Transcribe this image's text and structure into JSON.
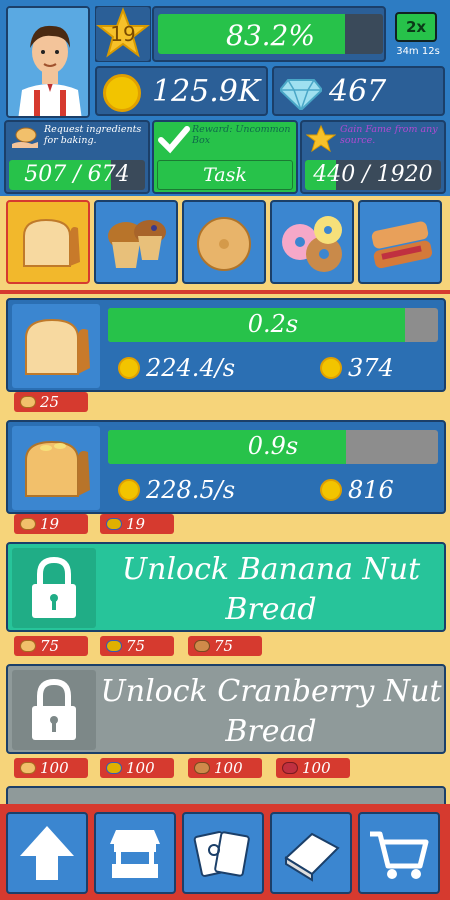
{
  "hud": {
    "level": "19",
    "xp_percent_text": "83.2%",
    "xp_fraction": 0.832,
    "boost": {
      "label": "2x",
      "time": "34m 12s"
    },
    "coins": "125.9K",
    "gems": "467"
  },
  "missions": [
    {
      "text": "Request ingredients for baking.",
      "progress": "507 / 674",
      "fraction": 0.752
    },
    {
      "text": "Reward: Uncommon Box",
      "progress": "Task Complete!",
      "fraction": 1.0
    },
    {
      "text": "Gain Fame from any source.",
      "progress": "440 / 1920",
      "fraction": 0.229
    }
  ],
  "tabs": [
    "bread-loaf",
    "muffins",
    "bagels",
    "donuts",
    "pastries"
  ],
  "items": [
    {
      "timer": "0.2s",
      "fraction": 0.9,
      "rate": "224.4/s",
      "cost": "374",
      "badges": [
        "25"
      ]
    },
    {
      "timer": "0.9s",
      "fraction": 0.72,
      "rate": "228.5/s",
      "cost": "816",
      "badges": [
        "19",
        "19"
      ]
    }
  ],
  "unlocks": [
    {
      "label": "Unlock Banana Nut Bread",
      "badges": [
        "75",
        "75",
        "75"
      ],
      "color": "#27c49a"
    },
    {
      "label": "Unlock Cranberry Nut Bread",
      "badges": [
        "100",
        "100",
        "100",
        "100"
      ],
      "color": "#8f9a9a"
    }
  ],
  "nav": [
    "upgrade-arrow-icon",
    "shop-stand-icon",
    "cards-icon",
    "recipe-book-icon",
    "cart-icon"
  ],
  "colors": {
    "accent_green": "#27c24a",
    "panel_blue": "#2b5f97",
    "red": "#d63a2f",
    "coin_gold": "#f2c400"
  }
}
